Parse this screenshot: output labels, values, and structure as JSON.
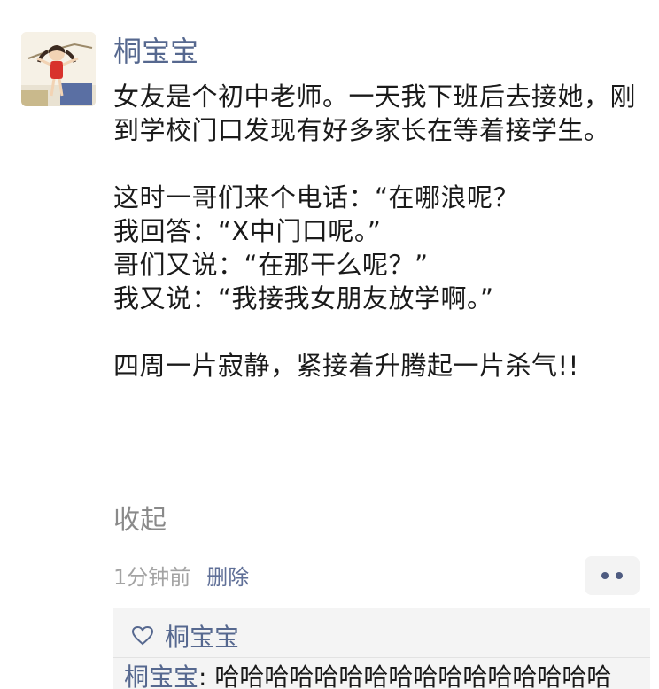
{
  "author": {
    "name": "桐宝宝"
  },
  "post": {
    "paragraphs": [
      "女友是个初中老师。一天我下班后去接她，刚到学校门口发现有好多家长在等着接学生。",
      "",
      "这时一哥们来个电话：“在哪浪呢？",
      "我回答：“X中门口呢。”",
      "哥们又说：“在那干么呢？”",
      "我又说：“我接我女朋友放学啊。”",
      "",
      "四周一片寂静，紧接着升腾起一片杀气!!"
    ],
    "collapse_label": "收起"
  },
  "meta": {
    "time": "1分钟前",
    "delete_label": "删除"
  },
  "likes": {
    "icon": "heart-outline-icon",
    "names": "桐宝宝"
  },
  "comment": {
    "user": "桐宝宝",
    "text": ": 哈哈哈哈哈哈哈哈哈哈哈哈哈哈哈哈"
  },
  "colors": {
    "link": "#56688f",
    "secondary": "#8a8a8a",
    "panel": "#f4f4f4"
  }
}
